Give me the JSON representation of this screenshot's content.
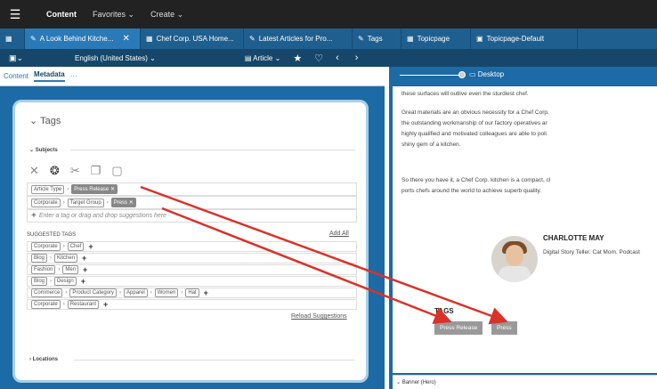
{
  "topbar": {
    "brand": "Content",
    "favorites": "Favorites",
    "create": "Create"
  },
  "tabs": [
    {
      "label": "A Look Behind Kitche...",
      "icon": "✎"
    },
    {
      "label": "Chef Corp. USA Home...",
      "icon": "▦"
    },
    {
      "label": "Latest Articles for Pro...",
      "icon": "✎"
    },
    {
      "label": "Tags",
      "icon": "✎"
    },
    {
      "label": "Topicpage",
      "icon": "▦"
    },
    {
      "label": "Topicpage-Default",
      "icon": "▣"
    }
  ],
  "toolbar": {
    "language": "English (United States)",
    "article": "Article"
  },
  "left": {
    "subtabs": [
      "Content",
      "Metadata",
      "···"
    ],
    "tags_heading": "Tags",
    "subjects_label": "Subjects",
    "row1": {
      "chip1": "Article Type",
      "chip2": "Press Release"
    },
    "row2": {
      "chip1": "Corporate",
      "chip2": "Target Group",
      "chip3": "Press"
    },
    "input_placeholder": "Enter a tag or drag and drop suggestions here",
    "suggested_label": "SUGGESTED TAGS",
    "add_all": "Add All",
    "suggestions": [
      [
        "Corporate",
        "Chef"
      ],
      [
        "Blog",
        "Kitchen"
      ],
      [
        "Fashion",
        "Men"
      ],
      [
        "Blog",
        "Design"
      ],
      [
        "Commerce",
        "Product Category",
        "Apparel",
        "Women",
        "Hat"
      ],
      [
        "Corporate",
        "Restaurant"
      ]
    ],
    "reload": "Reload Suggestions",
    "locations_label": "Locations"
  },
  "right": {
    "device": "Desktop",
    "p1": "these surfaces will outlive even the sturdiest chef.",
    "p2": "Great materials are an obvious necessity for a Chef Corp.",
    "p3": "the outstanding workmanship of our factory operatives ar",
    "p4": "highly qualified and motivated colleagues are able to poli",
    "p5": "shiny gem of a kitchen.",
    "p6": "So there you have it, a Chef Corp. kitchen is a compact, cl",
    "p7": "ports chefs around the world to achieve superb quality.",
    "author_name": "CHARLOTTE MAY",
    "author_bio": "Digital Story Teller. Cat Mom. Podcast",
    "tags_heading": "TAGS",
    "tag1": "Press Release",
    "tag2": "Press",
    "banner": "Banner (Hero)"
  },
  "colors": {
    "topbar": "#222222",
    "tabbar": "#1f5f8f",
    "toolbar": "#16476b",
    "panel_bg": "#1c6aa6",
    "arrow": "#d9322b"
  }
}
